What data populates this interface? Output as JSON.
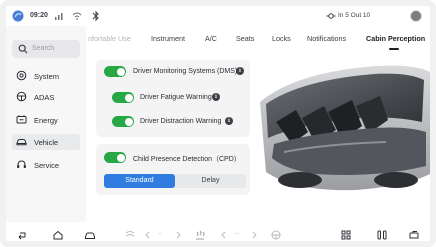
{
  "status_bar": {
    "time": "09:20",
    "trip_info": "In 5 Out 10",
    "icons": [
      "app-logo-icon",
      "signal-icon",
      "wifi-icon",
      "bluetooth-icon",
      "temperature-icon",
      "avatar"
    ]
  },
  "sidebar": {
    "search_placeholder": "Search",
    "items": [
      {
        "label": "System",
        "icon": "system-icon"
      },
      {
        "label": "ADAS",
        "icon": "adas-icon"
      },
      {
        "label": "Energy",
        "icon": "energy-icon"
      },
      {
        "label": "Vehicle",
        "icon": "vehicle-icon"
      },
      {
        "label": "Service",
        "icon": "service-icon"
      }
    ]
  },
  "tabs": [
    {
      "label": "nfortable Use",
      "state": "faded"
    },
    {
      "label": "Instrument",
      "state": "normal"
    },
    {
      "label": "A/C",
      "state": "normal"
    },
    {
      "label": "Seats",
      "state": "normal"
    },
    {
      "label": "Locks",
      "state": "normal"
    },
    {
      "label": "Notifications",
      "state": "normal"
    },
    {
      "label": "Cabin Perception",
      "state": "active"
    }
  ],
  "dms_panel": {
    "main": {
      "label": "Driver Monitoring Systems (DMS)",
      "enabled": true
    },
    "sub": [
      {
        "label": "Driver Fatigue Warning",
        "enabled": true
      },
      {
        "label": "Driver Distraction Warning",
        "enabled": true
      }
    ]
  },
  "cpd_panel": {
    "label": "Child Presence Detection（CPD）",
    "enabled": true,
    "options": [
      "Standard",
      "Delay"
    ],
    "selected": "Standard"
  },
  "dock": {
    "left_temp": "--",
    "right_temp": "--",
    "icons": [
      "back-icon",
      "home-icon",
      "car-icon",
      "fan-icon",
      "chevron-left-icon",
      "chevron-right-icon",
      "seat-heat-icon",
      "steering-heat-icon",
      "apps-icon",
      "media-icon",
      "settings-icon"
    ]
  },
  "colors": {
    "accent": "#2f7de1",
    "toggle_on": "#28a745",
    "panel_bg": "#f4f4f5"
  }
}
